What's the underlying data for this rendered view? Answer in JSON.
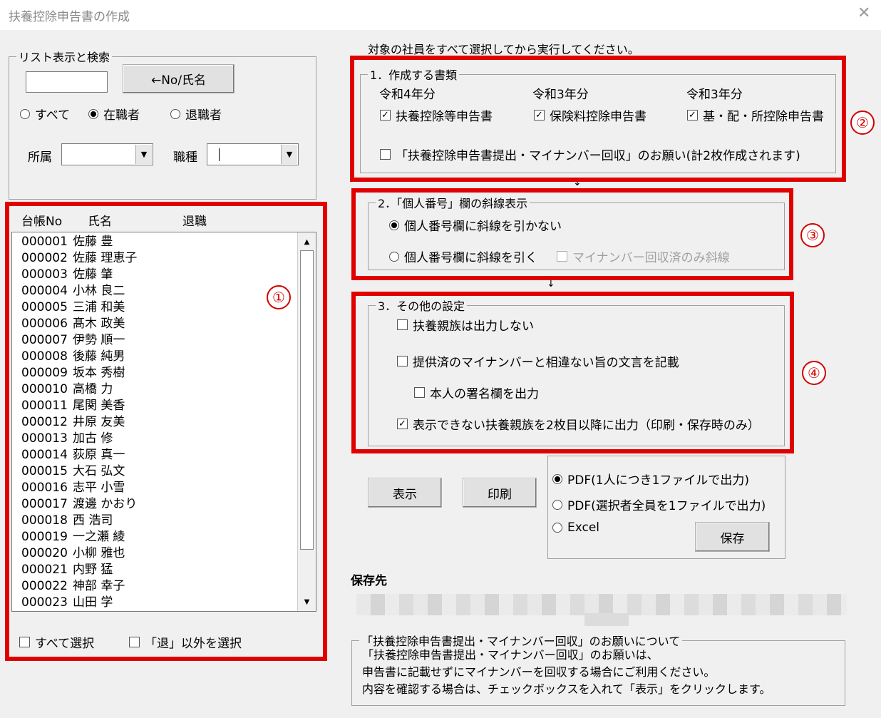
{
  "window": {
    "title": "扶養控除申告書の作成",
    "close_icon": "close-icon"
  },
  "search": {
    "legend": "リスト表示と検索",
    "input_value": "",
    "sort_button": "←No/氏名",
    "filter_options": [
      "すべて",
      "在職者",
      "退職者"
    ],
    "filter_selected": "在職者",
    "affiliation_label": "所属",
    "affiliation_value": "",
    "job_label": "職種",
    "job_value": ""
  },
  "list": {
    "headers": [
      "台帳No",
      "氏名",
      "退職"
    ],
    "rows": [
      {
        "no": "000001",
        "name": "佐藤 豊"
      },
      {
        "no": "000002",
        "name": "佐藤 理恵子"
      },
      {
        "no": "000003",
        "name": "佐藤 肇"
      },
      {
        "no": "000004",
        "name": "小林 良二"
      },
      {
        "no": "000005",
        "name": "三浦 和美"
      },
      {
        "no": "000006",
        "name": "髙木 政美"
      },
      {
        "no": "000007",
        "name": "伊勢 順一"
      },
      {
        "no": "000008",
        "name": "後藤 純男"
      },
      {
        "no": "000009",
        "name": "坂本 秀樹"
      },
      {
        "no": "000010",
        "name": "高橋 力"
      },
      {
        "no": "000011",
        "name": "尾関 美香"
      },
      {
        "no": "000012",
        "name": "井原 友美"
      },
      {
        "no": "000013",
        "name": "加古 修"
      },
      {
        "no": "000014",
        "name": "荻原 真一"
      },
      {
        "no": "000015",
        "name": "大石 弘文"
      },
      {
        "no": "000016",
        "name": "志平 小雪"
      },
      {
        "no": "000017",
        "name": "渡邊 かおり"
      },
      {
        "no": "000018",
        "name": "西 浩司"
      },
      {
        "no": "000019",
        "name": "一之瀬 綾"
      },
      {
        "no": "000020",
        "name": "小柳 雅也"
      },
      {
        "no": "000021",
        "name": "内野 猛"
      },
      {
        "no": "000022",
        "name": "神部 幸子"
      },
      {
        "no": "000023",
        "name": "山田 学"
      }
    ],
    "select_all": "すべて選択",
    "select_non_retired": "「退」以外を選択"
  },
  "instruction": "対象の社員をすべて選択してから実行してください。",
  "section1": {
    "legend": "1．作成する書類",
    "years": [
      "令和4年分",
      "令和3年分",
      "令和3年分"
    ],
    "documents": [
      {
        "label": "扶養控除等申告書",
        "checked": true
      },
      {
        "label": "保険料控除申告書",
        "checked": true
      },
      {
        "label": "基・配・所控除申告書",
        "checked": true
      }
    ],
    "request_label": "「扶養控除申告書提出・マイナンバー回収」のお願い(計2枚作成されます)",
    "request_checked": false
  },
  "section2": {
    "legend": "2．「個人番号」欄の斜線表示",
    "no_line": "個人番号欄に斜線を引かない",
    "draw_line": "個人番号欄に斜線を引く",
    "collected_only": "マイナンバー回収済のみ斜線"
  },
  "section3": {
    "legend": "3．その他の設定",
    "no_dependents": "扶養親族は出力しない",
    "statement": "提供済のマイナンバーと相違ない旨の文言を記載",
    "signature": "本人の署名欄を出力",
    "overflow": "表示できない扶養親族を2枚目以降に出力（印刷・保存時のみ）"
  },
  "actions": {
    "display": "表示",
    "print": "印刷",
    "output_options": [
      "PDF(1人につき1ファイルで出力)",
      "PDF(選択者全員を1ファイルで出力)",
      "Excel"
    ],
    "output_selected": "PDF(1人につき1ファイルで出力)",
    "save": "保存"
  },
  "save_destination_label": "保存先",
  "note": {
    "legend": "「扶養控除申告書提出・マイナンバー回収」のお願いについて",
    "lines": [
      "「扶養控除申告書提出・マイナンバー回収」のお願いは、",
      "申告書に記載せずにマイナンバーを回収する場合にご利用ください。",
      "内容を確認する場合は、チェックボックスを入れて「表示」をクリックします。"
    ]
  },
  "annotations": [
    "①",
    "②",
    "③",
    "④"
  ],
  "colors": {
    "highlight": "#e00000",
    "window_bg": "#f0f0f0"
  }
}
